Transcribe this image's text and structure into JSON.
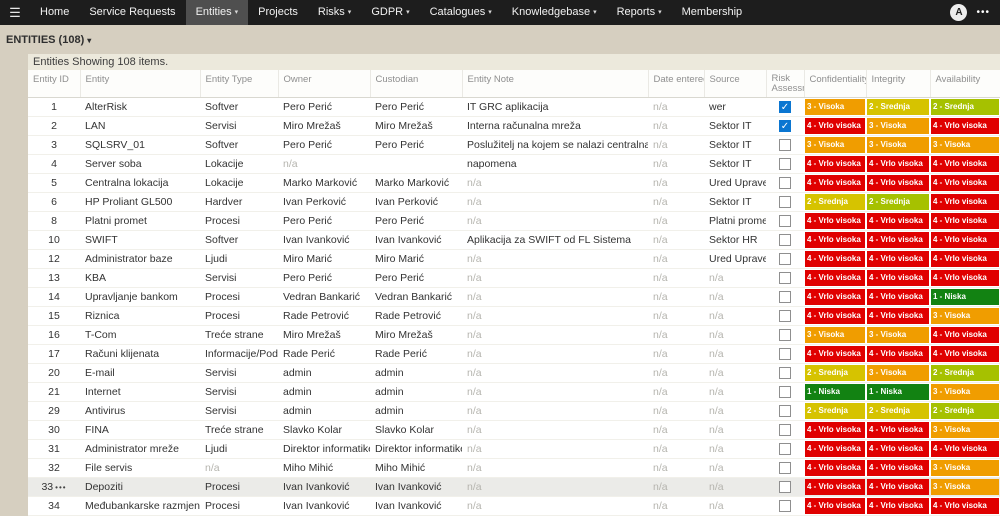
{
  "navbar": {
    "items": [
      {
        "label": "Home",
        "dropdown": false,
        "active": false
      },
      {
        "label": "Service Requests",
        "dropdown": false,
        "active": false
      },
      {
        "label": "Entities",
        "dropdown": true,
        "active": true
      },
      {
        "label": "Projects",
        "dropdown": false,
        "active": false
      },
      {
        "label": "Risks",
        "dropdown": true,
        "active": false
      },
      {
        "label": "GDPR",
        "dropdown": true,
        "active": false
      },
      {
        "label": "Catalogues",
        "dropdown": true,
        "active": false
      },
      {
        "label": "Knowledgebase",
        "dropdown": true,
        "active": false
      },
      {
        "label": "Reports",
        "dropdown": true,
        "active": false
      },
      {
        "label": "Membership",
        "dropdown": false,
        "active": false
      }
    ],
    "avatar_initial": "A",
    "icons": {
      "hamburger": "☰",
      "dropdown": "▾",
      "overflow": "•••",
      "check": "✓",
      "row_menu": "•••"
    }
  },
  "page": {
    "collection_label": "ENTITIES (108)",
    "summary": "Entities Showing 108 items."
  },
  "colors": {
    "navbar_bg": "#1d1d1d",
    "page_bg": "#d6cfc0",
    "badge_red": "#e00000",
    "badge_orange": "#f09d00",
    "badge_yellow": "#d6c300",
    "badge_yellow_green": "#a6c100",
    "badge_green": "#128212",
    "checkbox_checked": "#0b76d1"
  },
  "table": {
    "columns": [
      {
        "label": "Entity ID"
      },
      {
        "label": "Entity"
      },
      {
        "label": "Entity Type"
      },
      {
        "label": "Owner"
      },
      {
        "label": "Custodian"
      },
      {
        "label": "Entity Note"
      },
      {
        "label": "Date entered"
      },
      {
        "label": "Source"
      },
      {
        "label": "Risk Assessm",
        "wrap": true
      },
      {
        "label": "Confidentiality"
      },
      {
        "label": "Integrity"
      },
      {
        "label": "Availability"
      }
    ],
    "rows": [
      {
        "id": "1",
        "entity": "AlterRisk",
        "type": "Softver",
        "owner": "Pero Perić",
        "custodian": "Pero Perić",
        "note": "IT GRC aplikacija",
        "date": "n/a",
        "source": "wer",
        "risk_checked": true,
        "ratings": {
          "confidentiality": {
            "label": "3 - Visoka",
            "color": "#f09d00"
          },
          "integrity": {
            "label": "2 - Srednja",
            "color": "#d6c300"
          },
          "availability": {
            "label": "2 - Srednja",
            "color": "#a6c100"
          }
        }
      },
      {
        "id": "2",
        "entity": "LAN",
        "type": "Servisi",
        "owner": "Miro Mrežaš",
        "custodian": "Miro Mrežaš",
        "note": "Interna računalna mreža",
        "date": "n/a",
        "source": "Sektor IT",
        "risk_checked": true,
        "ratings": {
          "confidentiality": {
            "label": "4 - Vrlo visoka",
            "color": "#e00000"
          },
          "integrity": {
            "label": "3 - Visoka",
            "color": "#f09d00"
          },
          "availability": {
            "label": "4 - Vrlo visoka",
            "color": "#e00000"
          }
        }
      },
      {
        "id": "3",
        "entity": "SQLSRV_01",
        "type": "Softver",
        "owner": "Pero Perić",
        "custodian": "Pero Perić",
        "note": "Poslužitelj na kojem se nalazi centralna baza podataka",
        "date": "n/a",
        "source": "Sektor IT",
        "risk_checked": false,
        "ratings": {
          "confidentiality": {
            "label": "3 - Visoka",
            "color": "#f09d00"
          },
          "integrity": {
            "label": "3 - Visoka",
            "color": "#f09d00"
          },
          "availability": {
            "label": "3 - Visoka",
            "color": "#f09d00"
          }
        }
      },
      {
        "id": "4",
        "entity": "Server soba",
        "type": "Lokacije",
        "owner": "n/a",
        "custodian": "",
        "note": "napomena",
        "date": "n/a",
        "source": "Sektor IT",
        "risk_checked": false,
        "ratings": {
          "confidentiality": {
            "label": "4 - Vrlo visoka",
            "color": "#e00000"
          },
          "integrity": {
            "label": "4 - Vrlo visoka",
            "color": "#e00000"
          },
          "availability": {
            "label": "4 - Vrlo visoka",
            "color": "#e00000"
          }
        }
      },
      {
        "id": "5",
        "entity": "Centralna lokacija",
        "type": "Lokacije",
        "owner": "Marko Marković",
        "custodian": "Marko Marković",
        "note": "n/a",
        "date": "n/a",
        "source": "Ured Uprave",
        "risk_checked": false,
        "ratings": {
          "confidentiality": {
            "label": "4 - Vrlo visoka",
            "color": "#e00000"
          },
          "integrity": {
            "label": "4 - Vrlo visoka",
            "color": "#e00000"
          },
          "availability": {
            "label": "4 - Vrlo visoka",
            "color": "#e00000"
          }
        }
      },
      {
        "id": "6",
        "entity": "HP Proliant GL500",
        "type": "Hardver",
        "owner": "Ivan Perković",
        "custodian": "Ivan Perković",
        "note": "n/a",
        "date": "n/a",
        "source": "Sektor IT",
        "risk_checked": false,
        "ratings": {
          "confidentiality": {
            "label": "2 - Srednja",
            "color": "#d6c300"
          },
          "integrity": {
            "label": "2 - Srednja",
            "color": "#a6c100"
          },
          "availability": {
            "label": "4 - Vrlo visoka",
            "color": "#e00000"
          }
        }
      },
      {
        "id": "8",
        "entity": "Platni promet",
        "type": "Procesi",
        "owner": "Pero Perić",
        "custodian": "Pero Perić",
        "note": "n/a",
        "date": "n/a",
        "source": "Platni promet",
        "risk_checked": false,
        "ratings": {
          "confidentiality": {
            "label": "4 - Vrlo visoka",
            "color": "#e00000"
          },
          "integrity": {
            "label": "4 - Vrlo visoka",
            "color": "#e00000"
          },
          "availability": {
            "label": "4 - Vrlo visoka",
            "color": "#e00000"
          }
        }
      },
      {
        "id": "10",
        "entity": "SWIFT",
        "type": "Softver",
        "owner": "Ivan Ivanković",
        "custodian": "Ivan Ivanković",
        "note": "Aplikacija za SWIFT od FL Sistema",
        "date": "n/a",
        "source": "Sektor HR",
        "risk_checked": false,
        "ratings": {
          "confidentiality": {
            "label": "4 - Vrlo visoka",
            "color": "#e00000"
          },
          "integrity": {
            "label": "4 - Vrlo visoka",
            "color": "#e00000"
          },
          "availability": {
            "label": "4 - Vrlo visoka",
            "color": "#e00000"
          }
        }
      },
      {
        "id": "12",
        "entity": "Administrator baze",
        "type": "Ljudi",
        "owner": "Miro Marić",
        "custodian": "Miro Marić",
        "note": "n/a",
        "date": "n/a",
        "source": "Ured Uprave",
        "risk_checked": false,
        "ratings": {
          "confidentiality": {
            "label": "4 - Vrlo visoka",
            "color": "#e00000"
          },
          "integrity": {
            "label": "4 - Vrlo visoka",
            "color": "#e00000"
          },
          "availability": {
            "label": "4 - Vrlo visoka",
            "color": "#e00000"
          }
        }
      },
      {
        "id": "13",
        "entity": "KBA",
        "type": "Servisi",
        "owner": "Pero Perić",
        "custodian": "Pero Perić",
        "note": "n/a",
        "date": "n/a",
        "source": "n/a",
        "risk_checked": false,
        "ratings": {
          "confidentiality": {
            "label": "4 - Vrlo visoka",
            "color": "#e00000"
          },
          "integrity": {
            "label": "4 - Vrlo visoka",
            "color": "#e00000"
          },
          "availability": {
            "label": "4 - Vrlo visoka",
            "color": "#e00000"
          }
        }
      },
      {
        "id": "14",
        "entity": "Upravljanje bankom",
        "type": "Procesi",
        "owner": "Vedran Bankarić",
        "custodian": "Vedran Bankarić",
        "note": "n/a",
        "date": "n/a",
        "source": "n/a",
        "risk_checked": false,
        "ratings": {
          "confidentiality": {
            "label": "4 - Vrlo visoka",
            "color": "#e00000"
          },
          "integrity": {
            "label": "4 - Vrlo visoka",
            "color": "#e00000"
          },
          "availability": {
            "label": "1 - Niska",
            "color": "#128212"
          }
        }
      },
      {
        "id": "15",
        "entity": "Riznica",
        "type": "Procesi",
        "owner": "Rade Petrović",
        "custodian": "Rade Petrović",
        "note": "n/a",
        "date": "n/a",
        "source": "n/a",
        "risk_checked": false,
        "ratings": {
          "confidentiality": {
            "label": "4 - Vrlo visoka",
            "color": "#e00000"
          },
          "integrity": {
            "label": "4 - Vrlo visoka",
            "color": "#e00000"
          },
          "availability": {
            "label": "3 - Visoka",
            "color": "#f09d00"
          }
        }
      },
      {
        "id": "16",
        "entity": "T-Com",
        "type": "Treće strane",
        "owner": "Miro Mrežaš",
        "custodian": "Miro Mrežaš",
        "note": "n/a",
        "date": "n/a",
        "source": "n/a",
        "risk_checked": false,
        "ratings": {
          "confidentiality": {
            "label": "3 - Visoka",
            "color": "#f09d00"
          },
          "integrity": {
            "label": "3 - Visoka",
            "color": "#f09d00"
          },
          "availability": {
            "label": "4 - Vrlo visoka",
            "color": "#e00000"
          }
        }
      },
      {
        "id": "17",
        "entity": "Računi klijenata",
        "type": "Informacije/Podaci",
        "owner": "Rade Perić",
        "custodian": "Rade Perić",
        "note": "n/a",
        "date": "n/a",
        "source": "n/a",
        "risk_checked": false,
        "ratings": {
          "confidentiality": {
            "label": "4 - Vrlo visoka",
            "color": "#e00000"
          },
          "integrity": {
            "label": "4 - Vrlo visoka",
            "color": "#e00000"
          },
          "availability": {
            "label": "4 - Vrlo visoka",
            "color": "#e00000"
          }
        }
      },
      {
        "id": "20",
        "entity": "E-mail",
        "type": "Servisi",
        "owner": "admin",
        "custodian": "admin",
        "note": "n/a",
        "date": "n/a",
        "source": "n/a",
        "risk_checked": false,
        "ratings": {
          "confidentiality": {
            "label": "2 - Srednja",
            "color": "#d6c300"
          },
          "integrity": {
            "label": "3 - Visoka",
            "color": "#f09d00"
          },
          "availability": {
            "label": "2 - Srednja",
            "color": "#a6c100"
          }
        }
      },
      {
        "id": "21",
        "entity": "Internet",
        "type": "Servisi",
        "owner": "admin",
        "custodian": "admin",
        "note": "n/a",
        "date": "n/a",
        "source": "n/a",
        "risk_checked": false,
        "ratings": {
          "confidentiality": {
            "label": "1 - Niska",
            "color": "#128212"
          },
          "integrity": {
            "label": "1 - Niska",
            "color": "#128212"
          },
          "availability": {
            "label": "3 - Visoka",
            "color": "#f09d00"
          }
        }
      },
      {
        "id": "29",
        "entity": "Antivirus",
        "type": "Servisi",
        "owner": "admin",
        "custodian": "admin",
        "note": "n/a",
        "date": "n/a",
        "source": "n/a",
        "risk_checked": false,
        "ratings": {
          "confidentiality": {
            "label": "2 - Srednja",
            "color": "#d6c300"
          },
          "integrity": {
            "label": "2 - Srednja",
            "color": "#d6c300"
          },
          "availability": {
            "label": "2 - Srednja",
            "color": "#a6c100"
          }
        }
      },
      {
        "id": "30",
        "entity": "FINA",
        "type": "Treće strane",
        "owner": "Slavko Kolar",
        "custodian": "Slavko Kolar",
        "note": "n/a",
        "date": "n/a",
        "source": "n/a",
        "risk_checked": false,
        "ratings": {
          "confidentiality": {
            "label": "4 - Vrlo visoka",
            "color": "#e00000"
          },
          "integrity": {
            "label": "4 - Vrlo visoka",
            "color": "#e00000"
          },
          "availability": {
            "label": "3 - Visoka",
            "color": "#f09d00"
          }
        }
      },
      {
        "id": "31",
        "entity": "Administrator mreže",
        "type": "Ljudi",
        "owner": "Direktor informatike",
        "custodian": "Direktor informatike",
        "note": "n/a",
        "date": "n/a",
        "source": "n/a",
        "risk_checked": false,
        "ratings": {
          "confidentiality": {
            "label": "4 - Vrlo visoka",
            "color": "#e00000"
          },
          "integrity": {
            "label": "4 - Vrlo visoka",
            "color": "#e00000"
          },
          "availability": {
            "label": "4 - Vrlo visoka",
            "color": "#e00000"
          }
        }
      },
      {
        "id": "32",
        "entity": "File servis",
        "type": "n/a",
        "owner": "Miho Mihić",
        "custodian": "Miho Mihić",
        "note": "n/a",
        "date": "n/a",
        "source": "n/a",
        "risk_checked": false,
        "ratings": {
          "confidentiality": {
            "label": "4 - Vrlo visoka",
            "color": "#e00000"
          },
          "integrity": {
            "label": "4 - Vrlo visoka",
            "color": "#e00000"
          },
          "availability": {
            "label": "3 - Visoka",
            "color": "#f09d00"
          }
        }
      },
      {
        "id": "33",
        "entity": "Depoziti",
        "type": "Procesi",
        "owner": "Ivan Ivanković",
        "custodian": "Ivan Ivanković",
        "note": "n/a",
        "date": "n/a",
        "source": "n/a",
        "risk_checked": false,
        "highlighted": true,
        "menu": true,
        "ratings": {
          "confidentiality": {
            "label": "4 - Vrlo visoka",
            "color": "#e00000"
          },
          "integrity": {
            "label": "4 - Vrlo visoka",
            "color": "#e00000"
          },
          "availability": {
            "label": "3 - Visoka",
            "color": "#f09d00"
          }
        }
      },
      {
        "id": "34",
        "entity": "Međubankarske razmjene",
        "type": "Procesi",
        "owner": "Ivan Ivanković",
        "custodian": "Ivan Ivanković",
        "note": "n/a",
        "date": "n/a",
        "source": "n/a",
        "risk_checked": false,
        "ratings": {
          "confidentiality": {
            "label": "4 - Vrlo visoka",
            "color": "#e00000"
          },
          "integrity": {
            "label": "4 - Vrlo visoka",
            "color": "#e00000"
          },
          "availability": {
            "label": "4 - Vrlo visoka",
            "color": "#e00000"
          }
        }
      }
    ]
  }
}
